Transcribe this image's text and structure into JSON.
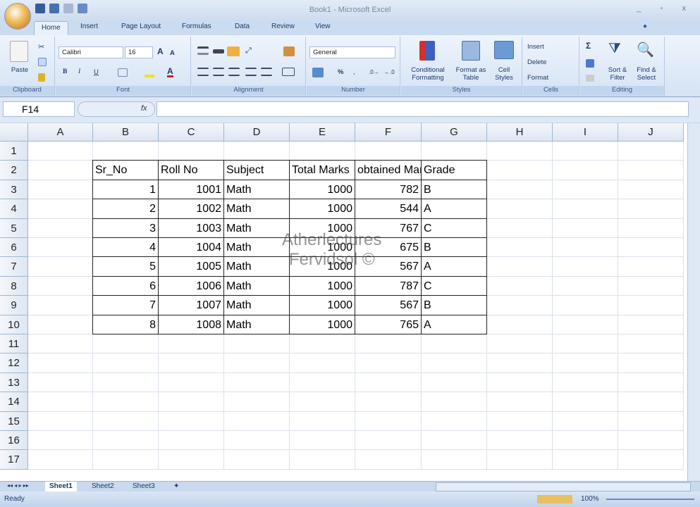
{
  "window": {
    "title": "Book1 - Microsoft Excel",
    "controls": "_ ▫ x"
  },
  "ribbon_tabs": [
    "Home",
    "Insert",
    "Page Layout",
    "Formulas",
    "Data",
    "Review",
    "View"
  ],
  "ribbon": {
    "clipboard": {
      "label": "Clipboard",
      "paste": "Paste"
    },
    "font": {
      "label": "Font",
      "name": "Calibri",
      "size": "16",
      "bold": "B",
      "italic": "I",
      "underline": "U"
    },
    "alignment": {
      "label": "Alignment"
    },
    "number": {
      "label": "Number",
      "format": "General",
      "percent": "%"
    },
    "styles": {
      "label": "Styles",
      "conditional": "Conditional Formatting",
      "format_table": "Format as Table",
      "cell_styles": "Cell Styles"
    },
    "cells": {
      "label": "Cells",
      "insert": "Insert",
      "delete": "Delete",
      "format": "Format"
    },
    "editing": {
      "label": "Editing",
      "sigma": "Σ",
      "sort": "Sort & Filter",
      "find": "Find & Select"
    }
  },
  "formula_bar": {
    "name_box": "F14",
    "fx": "fx",
    "value": ""
  },
  "columns": [
    "A",
    "B",
    "C",
    "D",
    "E",
    "F",
    "G",
    "H",
    "I",
    "J"
  ],
  "rows": [
    "1",
    "2",
    "3",
    "4",
    "5",
    "6",
    "7",
    "8",
    "9",
    "10",
    "11",
    "12",
    "13",
    "14",
    "15",
    "16",
    "17"
  ],
  "table": {
    "headers": [
      "Sr_No",
      "Roll No",
      "Subject",
      "Total Marks",
      "obtained Marks",
      "Grade"
    ],
    "rows": [
      [
        "1",
        "1001",
        "Math",
        "1000",
        "782",
        "B"
      ],
      [
        "2",
        "1002",
        "Math",
        "1000",
        "544",
        "A"
      ],
      [
        "3",
        "1003",
        "Math",
        "1000",
        "767",
        "C"
      ],
      [
        "4",
        "1004",
        "Math",
        "1000",
        "675",
        "B"
      ],
      [
        "5",
        "1005",
        "Math",
        "1000",
        "567",
        "A"
      ],
      [
        "6",
        "1006",
        "Math",
        "1000",
        "787",
        "C"
      ],
      [
        "7",
        "1007",
        "Math",
        "1000",
        "567",
        "B"
      ],
      [
        "8",
        "1008",
        "Math",
        "1000",
        "765",
        "A"
      ]
    ]
  },
  "watermark": {
    "line1": "Atherlectures",
    "line2": "Fervidsol ©"
  },
  "sheets": [
    "Sheet1",
    "Sheet2",
    "Sheet3"
  ],
  "status": {
    "text": "Ready",
    "zoom": "100%"
  }
}
